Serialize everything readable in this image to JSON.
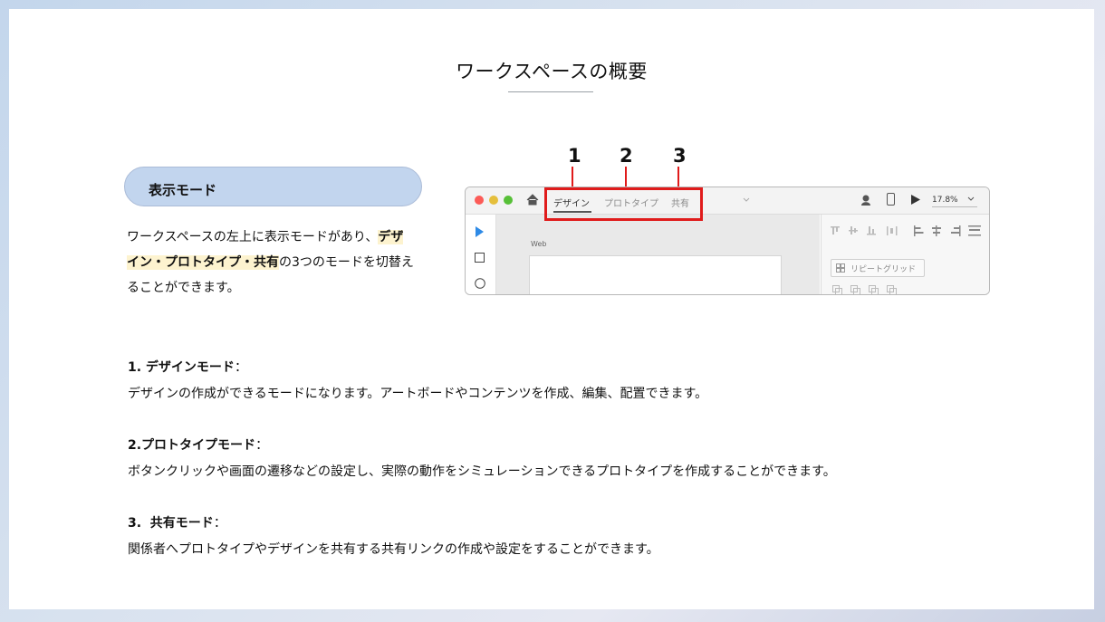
{
  "page_title": "ワークスペースの概要",
  "mode_heading": "表示モード",
  "intro": {
    "before": "ワークスペースの左上に表示モードがあり、",
    "highlight_1": "デザ",
    "highlight_2": "イン・プロトタイプ・共有",
    "after_1": "の3つのモードを切替え",
    "after_2": "ることができます。"
  },
  "screenshot": {
    "numbers": [
      "1",
      "2",
      "3"
    ],
    "tabs": [
      "デザイン",
      "プロトタイプ",
      "共有"
    ],
    "zoom": "17.8%",
    "artboard_label": "Web",
    "repeat_grid_label": "リピートグリッド",
    "dot_colors": [
      "#fc5b57",
      "#e5bf3c",
      "#57c038"
    ],
    "highlight_color": "#e01b1b"
  },
  "sections": [
    {
      "heading": "1. デザインモード",
      "colon": "：",
      "body": "デザインの作成ができるモードになります。アートボードやコンテンツを作成、編集、配置できます。"
    },
    {
      "heading": "2.プロトタイプモード",
      "colon": "：",
      "body": "ボタンクリックや画面の遷移などの設定し、実際の動作をシミュレーションできるプロトタイプを作成することができます。"
    },
    {
      "heading": "3.  共有モード",
      "colon": "：",
      "body": "関係者へプロトタイプやデザインを共有する共有リンクの作成や設定をすることができます。"
    }
  ]
}
